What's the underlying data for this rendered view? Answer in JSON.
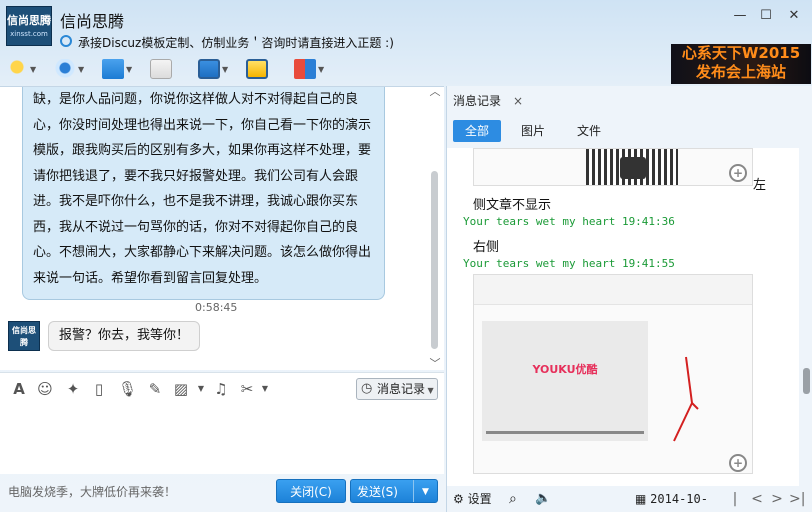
{
  "header": {
    "logo_text": "信尚思腾",
    "logo_sub": "xinsst.com",
    "chat_name": "信尚思腾",
    "signature": "承接Discuz模板定制、仿制业务＇咨询时请直接进入正题 :)",
    "banner_line1": "心系天下W2015",
    "banner_line2": "发布会上海站",
    "window_buttons": [
      "minimize",
      "maximize",
      "close"
    ]
  },
  "toolbar": {
    "icons": [
      "microphone-icon",
      "webcam-icon",
      "file-transfer-icon",
      "add-member-icon",
      "remote-desktop-icon",
      "screen-share-icon",
      "apps-icon"
    ]
  },
  "chat": {
    "message_lines": [
      "缺，是你人品问题，你说你这样做人对不对得起自己的良",
      "心，你没时间处理也得出来说一下，你自己看一下你的演示",
      "模版，跟我购买后的区别有多大，如果你再这样不处理，要",
      "请你把钱退了，要不我只好报警处理。我们公司有人会跟",
      "进。我不是吓你什么，也不是我不讲理，我诚心跟你买东",
      "西，我从不说过一句骂你的话，你对不对得起你自己的良",
      "心。不想闹大，大家都静心下来解决问题。该怎么做你得出",
      "来说一句话。希望你看到留言回复处理。"
    ],
    "time": "0:58:45",
    "reply": "报警？你去，我等你！",
    "avatar_text": "信尚思腾"
  },
  "input_bar": {
    "history_label": "消息记录"
  },
  "footer": {
    "ad_text": "电脑发烧季，大牌低价再来袭！",
    "close_label": "关闭(C)",
    "send_label": "发送(S)"
  },
  "panel": {
    "tab_label": "消息记录",
    "tab_close": "×",
    "filters": [
      "全部",
      "图片",
      "文件"
    ],
    "items": [
      {
        "text": "左"
      },
      {
        "text": "侧文章不显示"
      },
      {
        "meta": "Your tears wet my heart 19:41:36"
      },
      {
        "text": "右侧"
      },
      {
        "meta": "Your tears wet my heart 19:41:55"
      }
    ],
    "card_brand": "YOUKU优酷",
    "settings_label": "设置",
    "date": "2014-10-"
  }
}
